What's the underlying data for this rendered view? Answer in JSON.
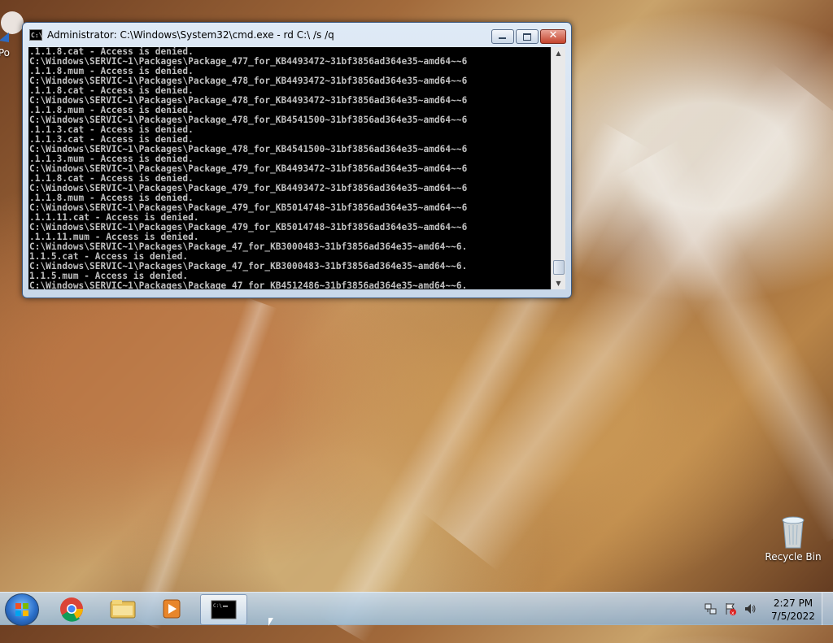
{
  "window": {
    "title": "Administrator: C:\\Windows\\System32\\cmd.exe - rd  C:\\ /s /q",
    "console_lines": [
      ".1.1.8.cat - Access is denied.",
      "C:\\Windows\\SERVIC~1\\Packages\\Package_477_for_KB4493472~31bf3856ad364e35~amd64~~6",
      ".1.1.8.mum - Access is denied.",
      "C:\\Windows\\SERVIC~1\\Packages\\Package_478_for_KB4493472~31bf3856ad364e35~amd64~~6",
      ".1.1.8.cat - Access is denied.",
      "C:\\Windows\\SERVIC~1\\Packages\\Package_478_for_KB4493472~31bf3856ad364e35~amd64~~6",
      ".1.1.8.mum - Access is denied.",
      "C:\\Windows\\SERVIC~1\\Packages\\Package_478_for_KB4541500~31bf3856ad364e35~amd64~~6",
      ".1.1.3.cat - Access is denied.",
      ".1.1.3.cat - Access is denied.",
      "C:\\Windows\\SERVIC~1\\Packages\\Package_478_for_KB4541500~31bf3856ad364e35~amd64~~6",
      ".1.1.3.mum - Access is denied.",
      "C:\\Windows\\SERVIC~1\\Packages\\Package_479_for_KB4493472~31bf3856ad364e35~amd64~~6",
      ".1.1.8.cat - Access is denied.",
      "C:\\Windows\\SERVIC~1\\Packages\\Package_479_for_KB4493472~31bf3856ad364e35~amd64~~6",
      ".1.1.8.mum - Access is denied.",
      "C:\\Windows\\SERVIC~1\\Packages\\Package_479_for_KB5014748~31bf3856ad364e35~amd64~~6",
      ".1.1.11.cat - Access is denied.",
      "C:\\Windows\\SERVIC~1\\Packages\\Package_479_for_KB5014748~31bf3856ad364e35~amd64~~6",
      ".1.1.11.mum - Access is denied.",
      "C:\\Windows\\SERVIC~1\\Packages\\Package_47_for_KB3000483~31bf3856ad364e35~amd64~~6.",
      "1.1.5.cat - Access is denied.",
      "C:\\Windows\\SERVIC~1\\Packages\\Package_47_for_KB3000483~31bf3856ad364e35~amd64~~6.",
      "1.1.5.mum - Access is denied.",
      "C:\\Windows\\SERVIC~1\\Packages\\Package_47_for_KB4512486~31bf3856ad364e35~amd64~~6."
    ]
  },
  "desktop": {
    "icons": [
      {
        "label": "Po",
        "icon": "chrome-shortcut-icon"
      },
      {
        "label": "Recycle Bin",
        "icon": "recycle-bin-icon"
      }
    ]
  },
  "taskbar": {
    "pinned": [
      "start-button",
      "chrome-icon",
      "explorer-icon",
      "media-player-icon",
      "cmd-icon"
    ],
    "clock_time": "2:27 PM",
    "clock_date": "7/5/2022"
  }
}
